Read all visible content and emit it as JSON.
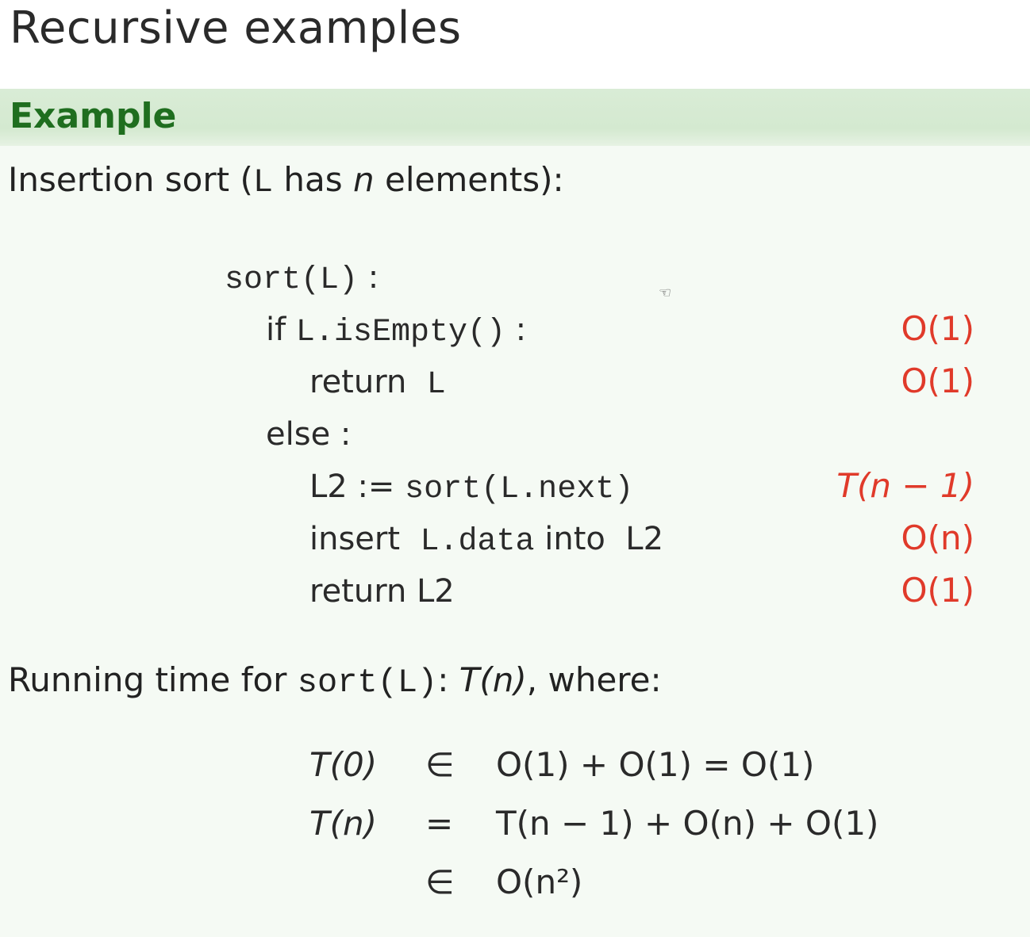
{
  "slide": {
    "title": "Recursive examples",
    "block_title": "Example",
    "intro": {
      "prefix": "Insertion sort (",
      "list_var": "L",
      "has": " has ",
      "n": "n",
      "suffix": " elements):"
    },
    "code": [
      {
        "id": "line1",
        "parts": [
          {
            "t": "sort(L)",
            "mono": true
          },
          {
            "t": " :"
          }
        ],
        "cost": ""
      },
      {
        "id": "line2",
        "parts": [
          {
            "t": "if "
          },
          {
            "t": "L.isEmpty()",
            "mono": true
          },
          {
            "t": " :"
          }
        ],
        "cost": "O(1)"
      },
      {
        "id": "line3",
        "parts": [
          {
            "t": "return  "
          },
          {
            "t": "L",
            "mono": true
          }
        ],
        "cost": "O(1)"
      },
      {
        "id": "line4",
        "parts": [
          {
            "t": "else :"
          }
        ],
        "cost": ""
      },
      {
        "id": "line5",
        "parts": [
          {
            "t": "L2 := "
          },
          {
            "t": "sort(L.next)",
            "mono": true
          }
        ],
        "cost": "T(n − 1)"
      },
      {
        "id": "line6",
        "parts": [
          {
            "t": "insert  "
          },
          {
            "t": "L.data",
            "mono": true
          },
          {
            "t": " into  L2"
          }
        ],
        "cost": "O(n)"
      },
      {
        "id": "line7",
        "parts": [
          {
            "t": "return L2"
          }
        ],
        "cost": "O(1)"
      }
    ],
    "running_time": {
      "prefix": "Running time for ",
      "call": "sort(L)",
      "colon": ": ",
      "func": "T(n)",
      "suffix": ", where:"
    },
    "equations": [
      {
        "lhs": "T(0)",
        "rel": "∈",
        "rhs": "O(1) + O(1) = O(1)"
      },
      {
        "lhs": "T(n)",
        "rel": "=",
        "rhs": "T(n − 1) + O(n) + O(1)"
      },
      {
        "lhs": "",
        "rel": "∈",
        "rhs": "O(n²)"
      }
    ],
    "colors": {
      "block_title": "#1f6e1f",
      "block_header_bg": "#d9ecd6",
      "block_body_bg": "#f5faf4",
      "cost": "#e03a2a"
    }
  }
}
